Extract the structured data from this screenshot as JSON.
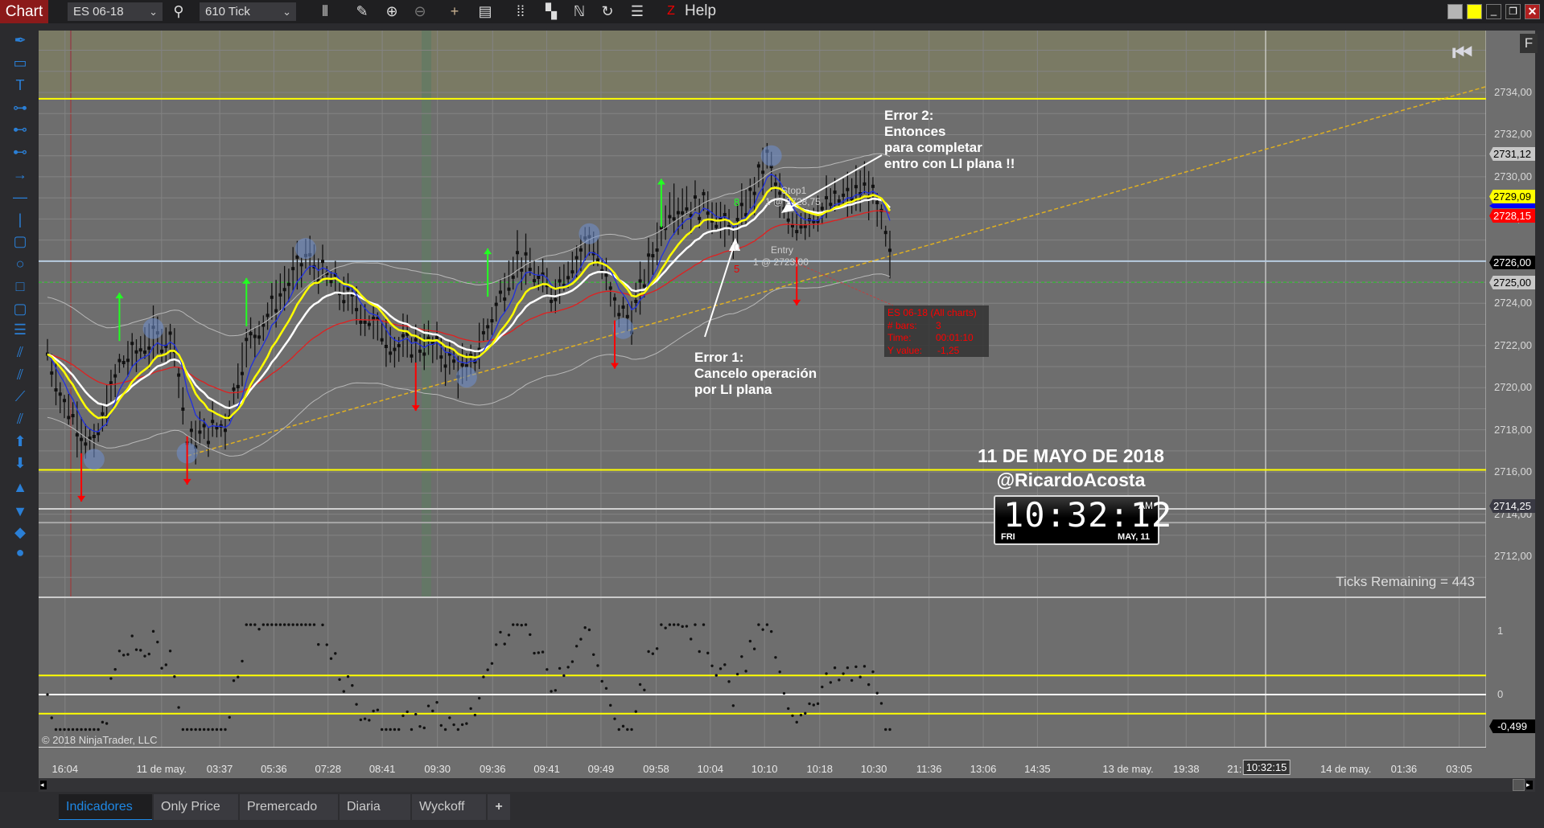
{
  "toolbar": {
    "chart_label": "Chart",
    "instrument": "ES 06-18",
    "interval": "610 Tick",
    "help_label": "Help",
    "icons": [
      "bar-type-icon",
      "pencil-icon",
      "zoom-in-icon",
      "zoom-out-icon",
      "crosshair-icon",
      "data-box-icon",
      "properties-icon",
      "strategies-icon",
      "indicators-icon",
      "refresh-icon",
      "list-icon",
      "z-icon"
    ]
  },
  "window": {
    "colors": [
      "#b5b5b5",
      "#ffff00"
    ]
  },
  "left_tools": [
    "pen",
    "ruler",
    "text",
    "line-seg",
    "ray",
    "ext-line",
    "arrow-line",
    "hline",
    "vline",
    "rect",
    "ellipse",
    "square",
    "square2",
    "fib",
    "andrews",
    "gann",
    "regression",
    "trend-channel",
    "up-arrow",
    "down-arrow",
    "triangle-up",
    "triangle-down",
    "diamond",
    "dot"
  ],
  "price_axis": {
    "ticks": [
      "2734,00",
      "2732,00",
      "2730,00",
      "2728,00",
      "2726,00",
      "2724,00",
      "2722,00",
      "2720,00",
      "2718,00",
      "2716,00",
      "2714,00",
      "2712,00"
    ],
    "markers": [
      {
        "label": "2731,12",
        "bg": "#c8c8c8",
        "fg": "#000"
      },
      {
        "label": "2729,09",
        "bg": "#ffff00",
        "fg": "#000"
      },
      {
        "label": "2728,15",
        "bg": "#ff0000",
        "fg": "#fff"
      },
      {
        "label": "2726,00",
        "bg": "#000000",
        "fg": "#fff"
      },
      {
        "label": "2725,00",
        "bg": "#c8c8c8",
        "fg": "#000"
      },
      {
        "label": "2714,25",
        "bg": "#3a3a44",
        "fg": "#fff"
      }
    ]
  },
  "osc_axis": {
    "ticks": [
      "1",
      "0"
    ],
    "marker": "-0,499"
  },
  "time_axis": {
    "labels": [
      "16:04",
      "11 de may.",
      "03:37",
      "05:36",
      "07:28",
      "08:41",
      "09:30",
      "09:36",
      "09:41",
      "09:49",
      "09:58",
      "10:04",
      "10:10",
      "10:18",
      "10:30",
      "11:36",
      "13:06",
      "14:35",
      "13 de may.",
      "19:38",
      "21:",
      "14 de may.",
      "01:36",
      "03:05"
    ],
    "current": "10:32:15"
  },
  "chart_data": {
    "type": "candlestick",
    "bars": 200,
    "price_waypoints": [
      [
        0,
        2721.6
      ],
      [
        4,
        2719.2
      ],
      [
        11,
        2717.1
      ],
      [
        17,
        2721.1
      ],
      [
        25,
        2722.3
      ],
      [
        30,
        2722.3
      ],
      [
        33,
        2717.4
      ],
      [
        42,
        2718.3
      ],
      [
        47,
        2722
      ],
      [
        61,
        2726.2
      ],
      [
        70,
        2724.4
      ],
      [
        82,
        2722
      ],
      [
        91,
        2722
      ],
      [
        99,
        2720.6
      ],
      [
        105,
        2723.4
      ],
      [
        111,
        2726.2
      ],
      [
        119,
        2724.4
      ],
      [
        128,
        2727.2
      ],
      [
        134,
        2723.9
      ],
      [
        138,
        2723.2
      ],
      [
        142,
        2725.8
      ],
      [
        147,
        2728.6
      ],
      [
        156,
        2728.6
      ],
      [
        162,
        2727.2
      ],
      [
        170,
        2730.9
      ],
      [
        175,
        2727.6
      ],
      [
        184,
        2728.6
      ],
      [
        194,
        2729.5
      ],
      [
        197,
        2727.9
      ],
      [
        199,
        2726.1
      ]
    ],
    "signals_down": [
      [
        8,
        2714.6
      ],
      [
        33,
        2715.4
      ],
      [
        87,
        2718.9
      ],
      [
        134,
        2720.9
      ],
      [
        177,
        2723.9
      ]
    ],
    "signals_up": [
      [
        17,
        2724.5
      ],
      [
        47,
        2725.2
      ],
      [
        104,
        2726.6
      ],
      [
        145,
        2729.9
      ]
    ],
    "circles": [
      [
        11,
        2716.6
      ],
      [
        25,
        2722.8
      ],
      [
        33,
        2716.9
      ],
      [
        61,
        2726.6
      ],
      [
        99,
        2720.5
      ],
      [
        128,
        2727.3
      ],
      [
        136,
        2722.8
      ],
      [
        171,
        2731
      ]
    ],
    "hlines": [
      {
        "price": 2733.7,
        "color": "#ffff00"
      },
      {
        "price": 2726,
        "color": "#b8cce0"
      },
      {
        "price": 2725,
        "color": "#22cc22",
        "dash": true
      },
      {
        "price": 2716.1,
        "color": "#ffff00"
      },
      {
        "price": 2714.25,
        "color": "#d0d0d0"
      },
      {
        "price": 2713.6,
        "color": "#a8a8a8"
      }
    ],
    "osc_levels": [
      0.3,
      0,
      -0.3
    ],
    "ylim": [
      2711,
      2736
    ]
  },
  "annotations": {
    "error1": "Error 1:\nCancelo operación\npor LI plana",
    "error2": "Error 2:\nEntonces\npara completar\nentro con LI plana !!",
    "date": "11 DE MAYO DE 2018",
    "handle": "@RicardoAcosta",
    "stop_label": "Stop1",
    "stop_val": "1 @ 2728,75",
    "entry_label": "Entry",
    "entry_val": "1 @ 2723,00",
    "num8": "8",
    "num5": "5",
    "num0": "0"
  },
  "tooltip": {
    "title": "ES 06-18 (All charts)",
    "bars_label": "# bars:",
    "bars": "3",
    "time_label": "Time:",
    "time": "00:01:10",
    "y_label": "Y value:",
    "y": "-1,25"
  },
  "clock": {
    "time": "10:32:12",
    "ampm": "AM",
    "day": "FRI",
    "date": "MAY, 11"
  },
  "ticks_remaining": "Ticks Remaining = 443",
  "copyright": "© 2018 NinjaTrader, LLC",
  "f_button": "F",
  "tabs": [
    {
      "label": "Indicadores",
      "active": true
    },
    {
      "label": "Only Price"
    },
    {
      "label": "Premercado"
    },
    {
      "label": "Diaria"
    },
    {
      "label": "Wyckoff"
    },
    {
      "label": "+"
    }
  ]
}
